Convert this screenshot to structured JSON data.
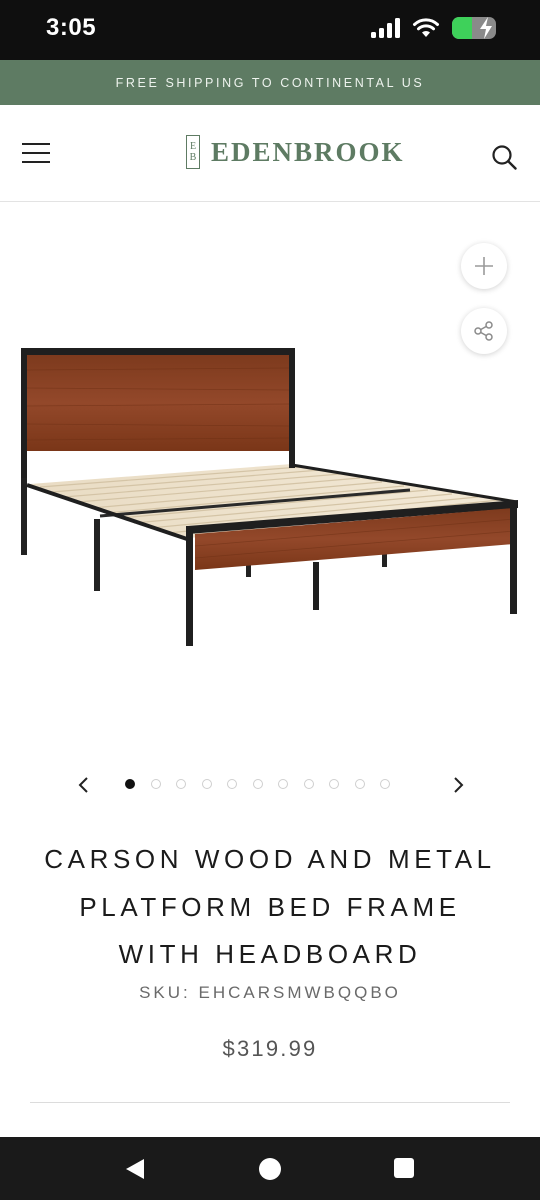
{
  "status_bar": {
    "time": "3:05",
    "icons": [
      "signal-icon",
      "wifi-icon",
      "battery-charging-icon"
    ],
    "battery_level": 0.45
  },
  "promo": {
    "text": "FREE SHIPPING TO CONTINENTAL US"
  },
  "header": {
    "logo_mark": [
      "E",
      "B"
    ],
    "logo_text": "EDENBROOK",
    "menu_icon": "hamburger-menu-icon",
    "search_icon": "search-icon"
  },
  "gallery": {
    "image_alt": "Carson wood and metal platform bed frame with headboard",
    "zoom_icon": "plus-icon",
    "share_icon": "share-icon",
    "dot_count": 11,
    "active_index": 0
  },
  "product": {
    "title_lines": [
      "CARSON WOOD AND METAL",
      "PLATFORM BED FRAME",
      "WITH HEADBOARD"
    ],
    "sku": "SKU: EHCARSMWBQQBO",
    "price": "$319.99"
  },
  "colors": {
    "brand_green": "#5e7b63",
    "wood": "#8a3f1f",
    "frame": "#1f1f1f"
  }
}
